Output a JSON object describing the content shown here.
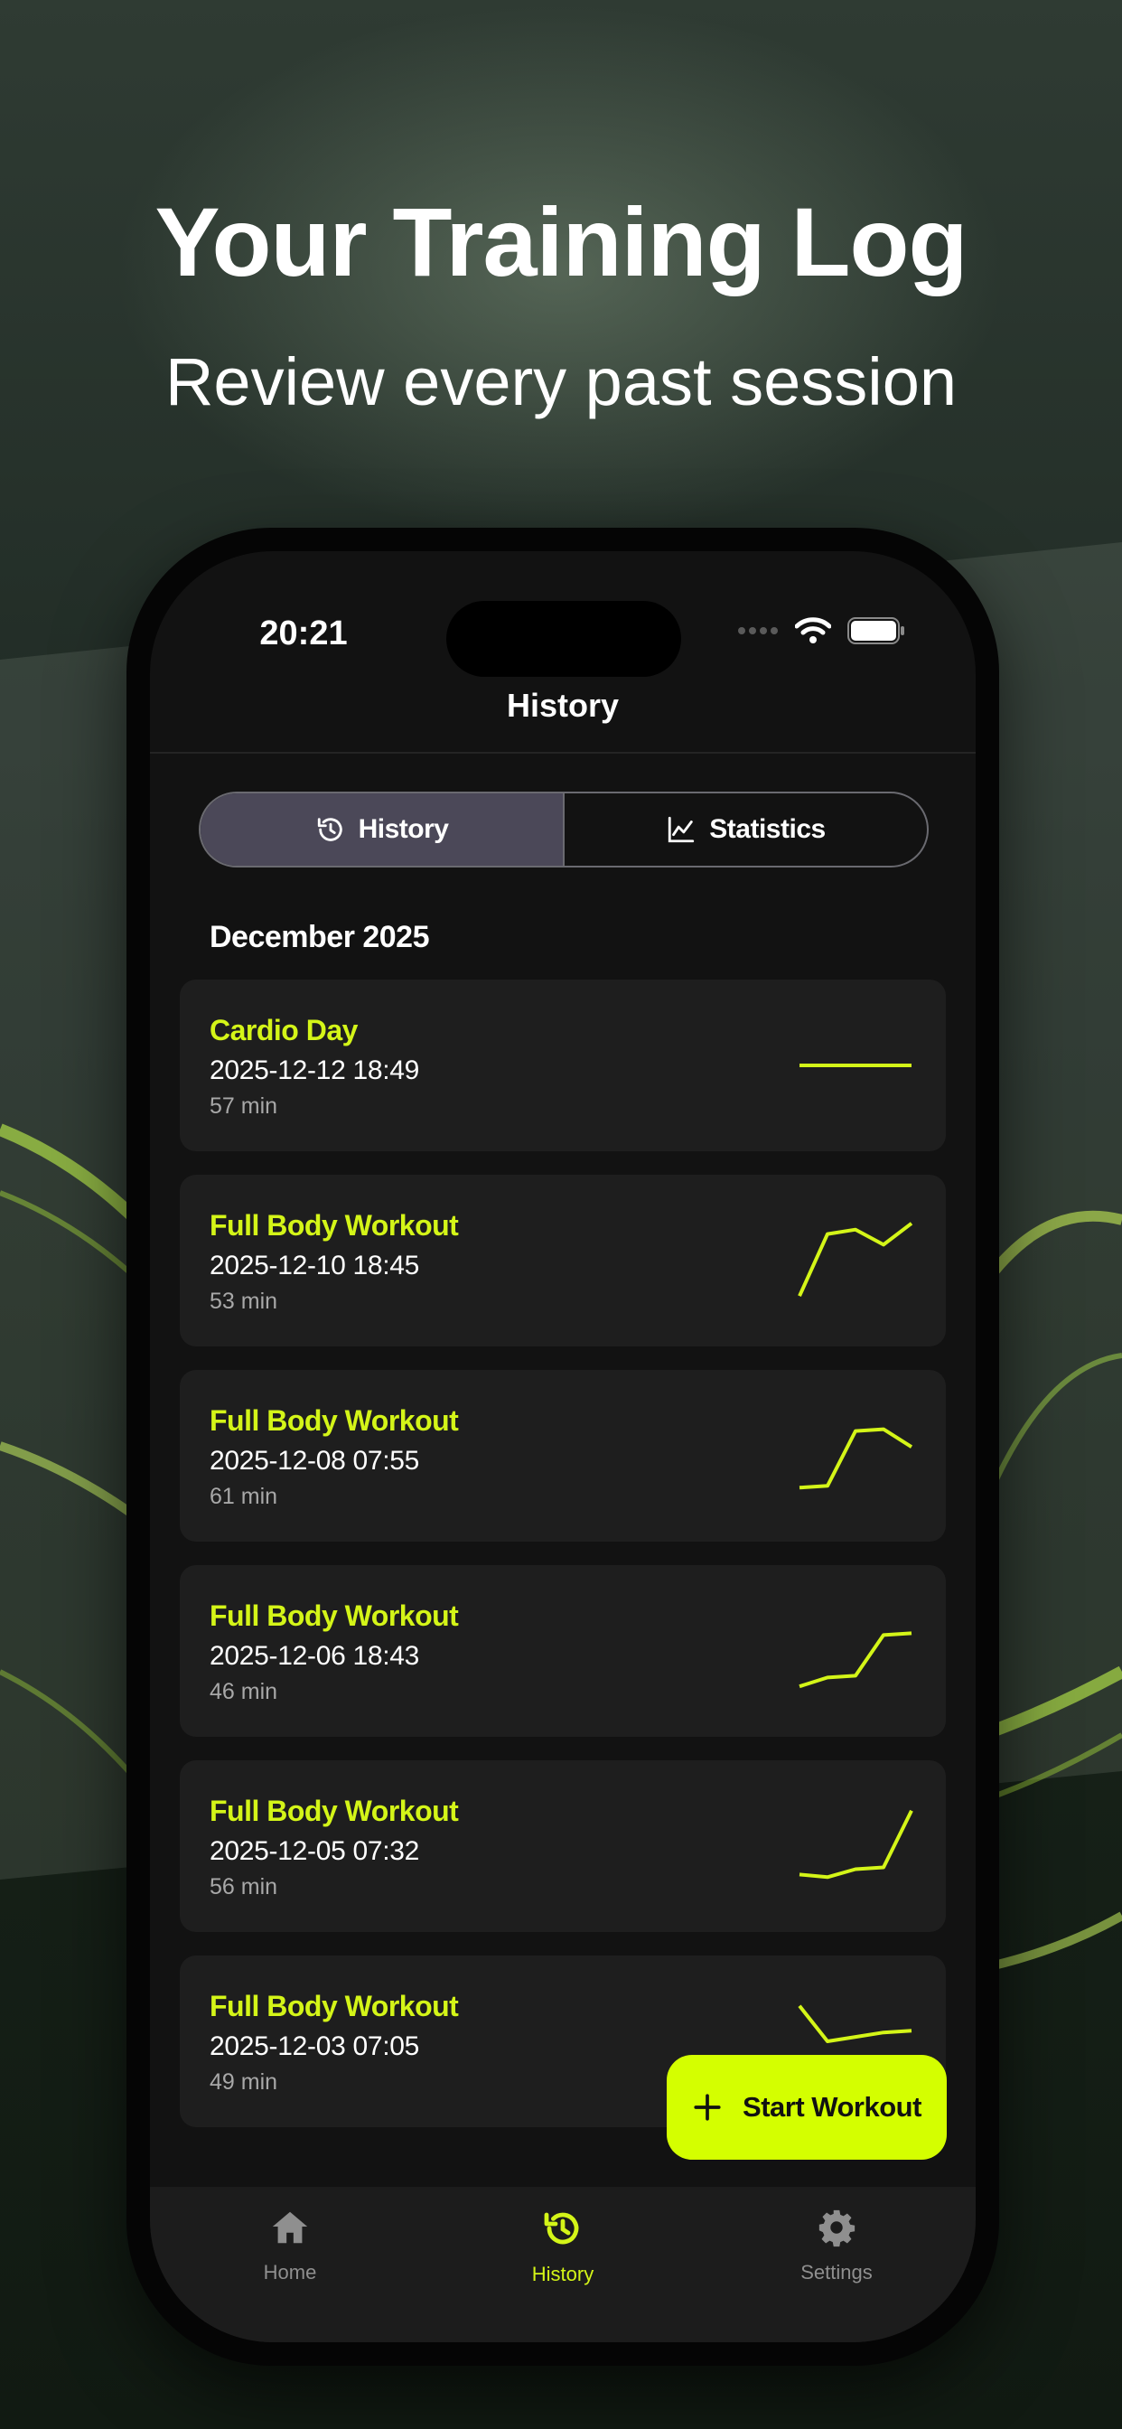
{
  "marketing": {
    "title": "Your Training Log",
    "subtitle": "Review every past session"
  },
  "status_bar": {
    "time": "20:21"
  },
  "nav": {
    "title": "History"
  },
  "segmented": [
    {
      "label": "History",
      "icon": "history-icon",
      "selected": true
    },
    {
      "label": "Statistics",
      "icon": "chart-icon",
      "selected": false
    }
  ],
  "section": {
    "month": "December 2025"
  },
  "workouts": [
    {
      "name": "Cardio Day",
      "datetime": "2025-12-12 18:49",
      "duration": "57 min",
      "trend": [
        0.5,
        0.5,
        0.5,
        0.5,
        0.5
      ]
    },
    {
      "name": "Full Body Workout",
      "datetime": "2025-12-10 18:45",
      "duration": "53 min",
      "trend": [
        0.1,
        0.8,
        0.85,
        0.68,
        0.92
      ]
    },
    {
      "name": "Full Body Workout",
      "datetime": "2025-12-08 07:55",
      "duration": "61 min",
      "trend": [
        0.14,
        0.16,
        0.78,
        0.8,
        0.6
      ]
    },
    {
      "name": "Full Body Workout",
      "datetime": "2025-12-06 18:43",
      "duration": "46 min",
      "trend": [
        0.1,
        0.2,
        0.22,
        0.68,
        0.7
      ]
    },
    {
      "name": "Full Body Workout",
      "datetime": "2025-12-05 07:32",
      "duration": "56 min",
      "trend": [
        0.18,
        0.15,
        0.24,
        0.26,
        0.9
      ]
    },
    {
      "name": "Full Body Workout",
      "datetime": "2025-12-03 07:05",
      "duration": "49 min",
      "trend": [
        0.9,
        0.5,
        0.55,
        0.6,
        0.62
      ]
    }
  ],
  "fab": {
    "label": "Start Workout",
    "icon": "plus-icon"
  },
  "tabs": [
    {
      "label": "Home",
      "icon": "home-icon",
      "active": false
    },
    {
      "label": "History",
      "icon": "history-icon",
      "active": true
    },
    {
      "label": "Settings",
      "icon": "gear-icon",
      "active": false
    }
  ],
  "colors": {
    "accent": "#d4ff00",
    "card": "#1e1e1e",
    "screen": "#121212",
    "segment_active": "#4b4858"
  }
}
